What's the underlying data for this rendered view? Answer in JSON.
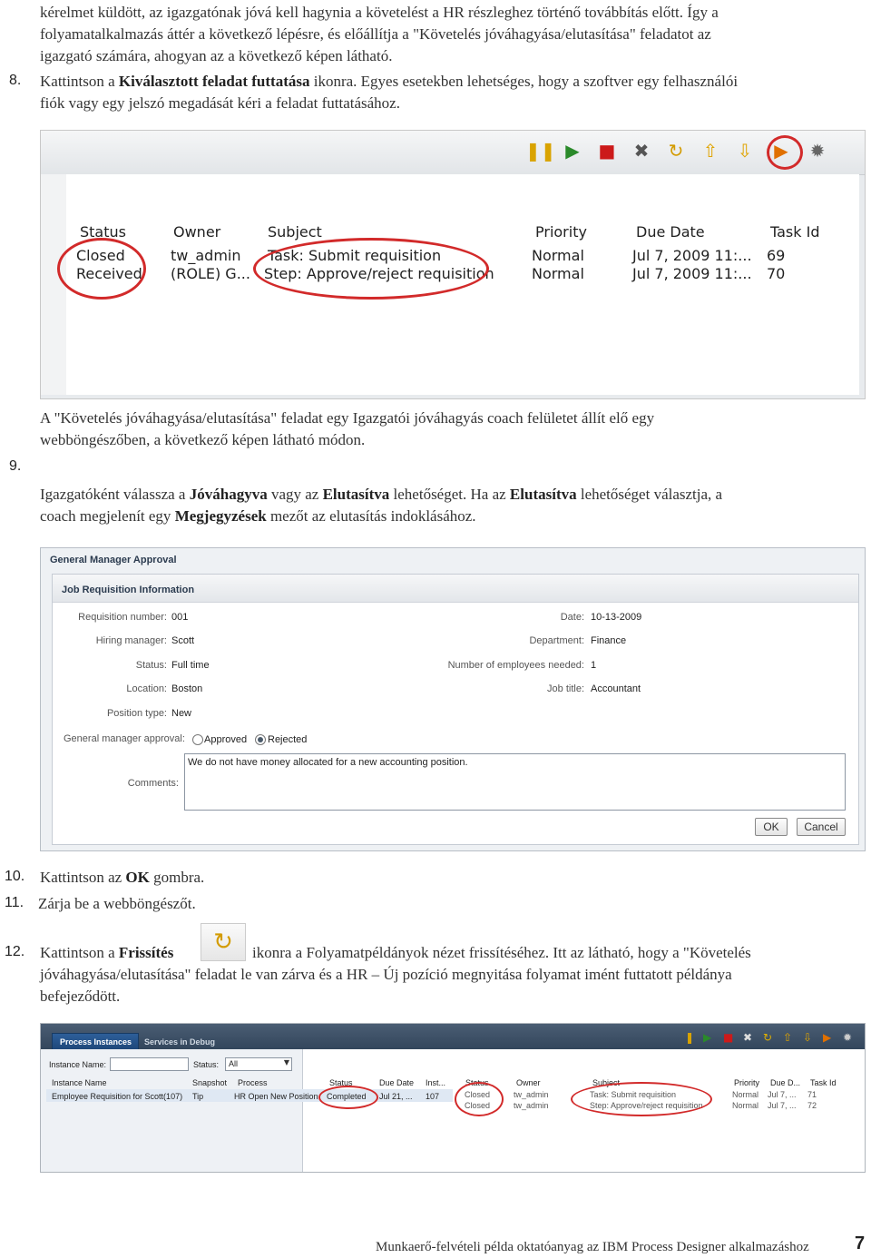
{
  "intro": {
    "line1": "kérelmet küldött, az igazgatónak jóvá kell hagynia a követelést a HR részleghez történő továbbítás előtt. Így a",
    "line2": "folyamatalkalmazás áttér a következő lépésre, és előállítja a \"Követelés jóváhagyása/elutasítása\" feladatot az",
    "line3": "igazgató számára, ahogyan az a következő képen látható."
  },
  "step8": {
    "num": "8.",
    "pre": "Kattintson a",
    "bold": "Kiválasztott feladat futtatása",
    "post": "ikonra.",
    "rest1": "Egyes esetekben lehetséges, hogy a szoftver egy felhasználói",
    "rest2": "fiók vagy egy jelszó megadását kéri a feladat futtatásához."
  },
  "shot1": {
    "toolbar_icons": [
      "pause-icon",
      "resume-icon",
      "stop-icon",
      "delete-icon",
      "refresh-icon",
      "move-up-icon",
      "move-down-icon",
      "run-task-icon",
      "debug-icon"
    ],
    "headers": [
      "Status",
      "Owner",
      "Subject",
      "Priority",
      "Due Date",
      "Task Id"
    ],
    "rows": [
      [
        "Closed",
        "tw_admin",
        "Task: Submit requisition",
        "Normal",
        "Jul 7, 2009 11:...",
        "69"
      ],
      [
        "Received",
        "(ROLE) G...",
        "Step: Approve/reject requisition",
        "Normal",
        "Jul 7, 2009 11:...",
        "70"
      ]
    ],
    "highlight_color": "#d22a2a"
  },
  "step9": {
    "num": "9.",
    "p1a": "A \"Követelés jóváhagyása/elutasítása\" feladat egy Igazgatói jóváhagyás coach felületet állít elő egy",
    "p1b": "webböngészőben, a következő képen látható módon.",
    "p2a_pre": "Igazgatóként válassza a",
    "p2a_b1": "Jóváhagyva",
    "p2a_mid": "vagy az",
    "p2a_b2": "Elutasítva",
    "p2a_mid2": "lehetőséget. Ha az",
    "p2a_b3": "Elutasítva",
    "p2a_post": "lehetőséget választja, a",
    "p2b_pre": "coach megjelenít egy",
    "p2b_b": "Megjegyzések",
    "p2b_post": "mezőt az elutasítás indoklásához."
  },
  "shot2": {
    "title": "General Manager Approval",
    "section": "Job Requisition Information",
    "left_labels": [
      "Requisition number:",
      "Hiring manager:",
      "Status:",
      "Location:",
      "Position type:"
    ],
    "left_values": [
      "001",
      "Scott",
      "Full time",
      "Boston",
      "New"
    ],
    "right_labels": [
      "Date:",
      "Department:",
      "Number of employees needed:",
      "Job title:"
    ],
    "right_values": [
      "10-13-2009",
      "Finance",
      "1",
      "Accountant"
    ],
    "approval_label": "General manager approval:",
    "approved": "Approved",
    "rejected": "Rejected",
    "selected": "Rejected",
    "comments_label": "Comments:",
    "comments_value": "We do  not have money allocated for a new accounting position.",
    "ok": "OK",
    "cancel": "Cancel"
  },
  "step10": {
    "num": "10.",
    "pre": "Kattintson az",
    "bold": "OK",
    "post": "gombra."
  },
  "step11": {
    "num": "11.",
    "text": "Zárja be a webböngészőt."
  },
  "step12": {
    "num": "12.",
    "pre": "Kattintson a",
    "bold": "Frissítés",
    "icon": "refresh-icon",
    "post": "ikonra a Folyamatpéldányok nézet frissítéséhez. Itt az látható, hogy a \"Követelés",
    "line2": "jóváhagyása/elutasítása\" feladat le van zárva és a HR – Új pozíció megnyitása folyamat imént futtatott példánya",
    "line3": "befejeződött."
  },
  "shot3": {
    "tabs": [
      "Process Instances",
      "Services in Debug"
    ],
    "instance_name_label": "Instance Name:",
    "status_label": "Status:",
    "status_value": "All",
    "left_headers": [
      "Instance Name",
      "Snapshot",
      "Process",
      "Status",
      "Due Date",
      "Inst..."
    ],
    "left_row": [
      "Employee Requisition for Scott(107)",
      "Tip",
      "HR Open New Position",
      "Completed",
      "Jul 21, ...",
      "107"
    ],
    "right_headers": [
      "Status",
      "Owner",
      "Subject",
      "Priority",
      "Due D...",
      "Task Id"
    ],
    "right_rows": [
      [
        "Closed",
        "tw_admin",
        "Task: Submit requisition",
        "Normal",
        "Jul 7, ...",
        "71"
      ],
      [
        "Closed",
        "tw_admin",
        "Step: Approve/reject requisition",
        "Normal",
        "Jul 7, ...",
        "72"
      ]
    ]
  },
  "footer": {
    "text": "Munkaerő-felvételi példa oktatóanyag az IBM Process Designer alkalmazáshoz",
    "page": "7"
  }
}
